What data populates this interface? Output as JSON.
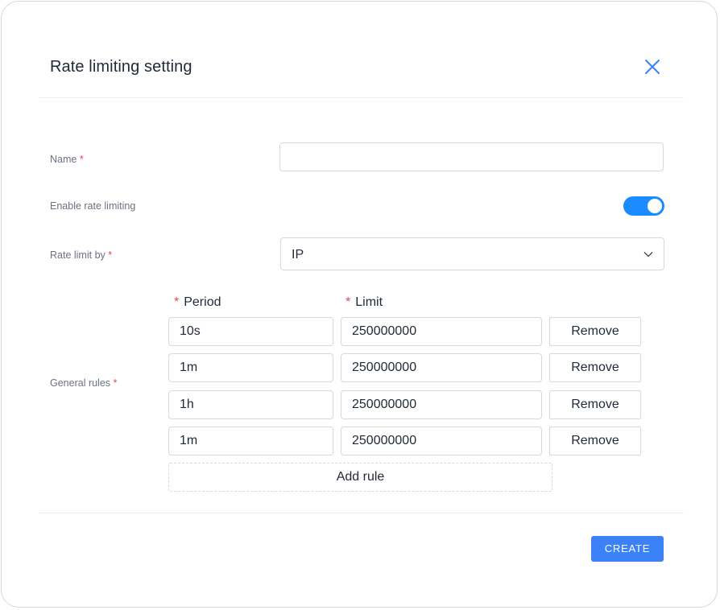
{
  "dialog": {
    "title": "Rate limiting setting",
    "close_icon": "close-icon"
  },
  "form": {
    "name": {
      "label": "Name",
      "required_mark": "*",
      "value": "",
      "placeholder": ""
    },
    "enable": {
      "label": "Enable rate limiting",
      "checked": true
    },
    "rate_limit_by": {
      "label": "Rate limit by",
      "required_mark": "*",
      "value": "IP",
      "icon": "chevron-down-icon"
    },
    "general_rules": {
      "label": "General rules",
      "required_mark": "*",
      "period_header": "Period",
      "limit_header": "Limit",
      "header_required_mark": "*",
      "rules": [
        {
          "period": "10s",
          "limit": "250000000",
          "remove_label": "Remove"
        },
        {
          "period": "1m",
          "limit": "250000000",
          "remove_label": "Remove"
        },
        {
          "period": "1h",
          "limit": "250000000",
          "remove_label": "Remove"
        },
        {
          "period": "1m",
          "limit": "250000000",
          "remove_label": "Remove"
        }
      ],
      "add_rule_label": "Add rule"
    }
  },
  "footer": {
    "create_label": "CREATE"
  },
  "colors": {
    "accent": "#3b82f6",
    "toggle_on": "#1a8cff",
    "required": "#e5484d"
  }
}
